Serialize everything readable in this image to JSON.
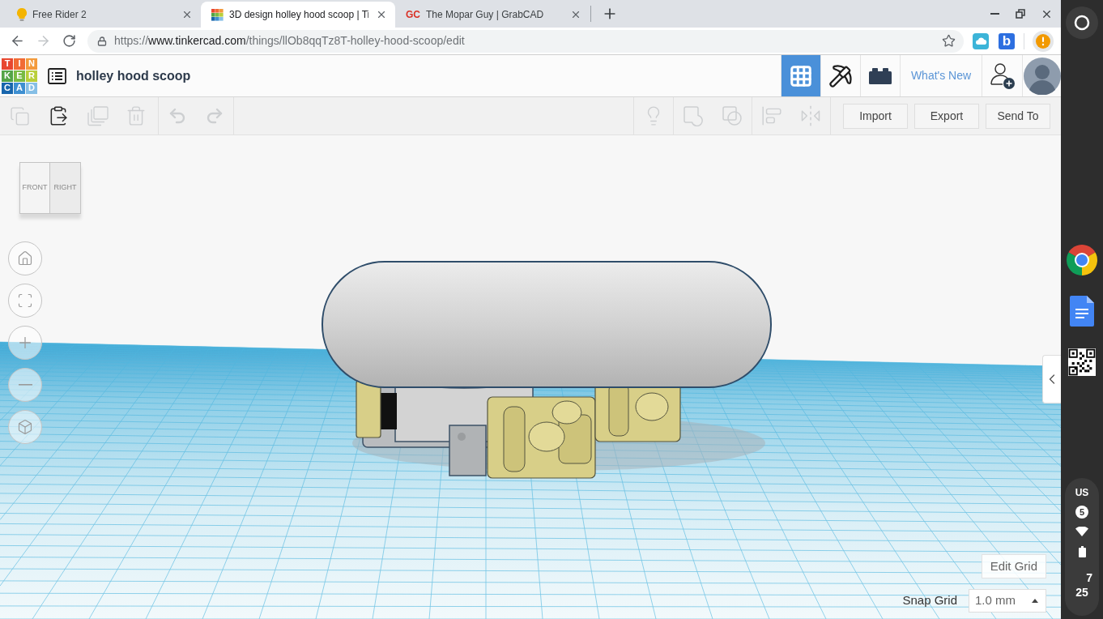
{
  "browser": {
    "tabs": [
      {
        "kind": "bulb",
        "title": "Free Rider 2",
        "selected": false
      },
      {
        "kind": "tinkercad",
        "title": "3D design holley hood scoop | Ti",
        "selected": true
      },
      {
        "kind": "text",
        "favicon_text": "GC",
        "title": "The Mopar Guy | GrabCAD",
        "selected": false
      }
    ],
    "nav": [
      {
        "kind": "back",
        "disabled": false
      },
      {
        "kind": "forward",
        "disabled": true
      },
      {
        "kind": "reload",
        "disabled": false
      }
    ],
    "address": {
      "scheme": "https://",
      "host": "www.tinkercad.com",
      "path": "/things/llOb8qqTz8T-holley-hood-scoop/edit"
    },
    "extensions": [
      {
        "kind": "cloud"
      },
      {
        "kind": "letter",
        "label": "b"
      }
    ]
  },
  "app": {
    "logo_letters": [
      "T",
      "I",
      "N",
      "K",
      "E",
      "R",
      "C",
      "A",
      "D"
    ],
    "design_title": "holley hood scoop",
    "views": [
      {
        "kind": "design",
        "selected": true
      },
      {
        "kind": "blocks",
        "selected": false
      },
      {
        "kind": "bricks",
        "selected": false
      }
    ],
    "whats_new": "What's New"
  },
  "toolbar": {
    "edit_tools": [
      {
        "kind": "copy",
        "disabled": true
      },
      {
        "kind": "paste",
        "disabled": false
      },
      {
        "kind": "duplicate",
        "disabled": true
      },
      {
        "kind": "delete",
        "disabled": true
      }
    ],
    "history": [
      {
        "kind": "undo",
        "disabled": true
      },
      {
        "kind": "redo",
        "disabled": true
      }
    ],
    "shape_tools": [
      {
        "kind": "light",
        "disabled": true
      },
      {
        "kind": "group",
        "disabled": true
      },
      {
        "kind": "ungroup",
        "disabled": true
      },
      {
        "kind": "align",
        "disabled": true
      },
      {
        "kind": "mirror",
        "disabled": true
      }
    ],
    "buttons": [
      "Import",
      "Export",
      "Send To"
    ]
  },
  "workplane": {
    "view_cube": [
      "FRONT",
      "RIGHT"
    ],
    "view_controls": [
      {
        "kind": "home"
      },
      {
        "kind": "fit"
      },
      {
        "kind": "zoom_in"
      },
      {
        "kind": "zoom_out"
      },
      {
        "kind": "ortho"
      }
    ],
    "edit_grid": "Edit Grid",
    "snap_grid": {
      "label": "Snap Grid",
      "value": "1.0 mm"
    }
  },
  "shelf": {
    "apps": [
      {
        "kind": "chrome"
      },
      {
        "kind": "docs"
      },
      {
        "kind": "qr"
      }
    ],
    "tray": {
      "ime": "US",
      "notifications": "5",
      "hour": "7",
      "minute": "25"
    }
  }
}
